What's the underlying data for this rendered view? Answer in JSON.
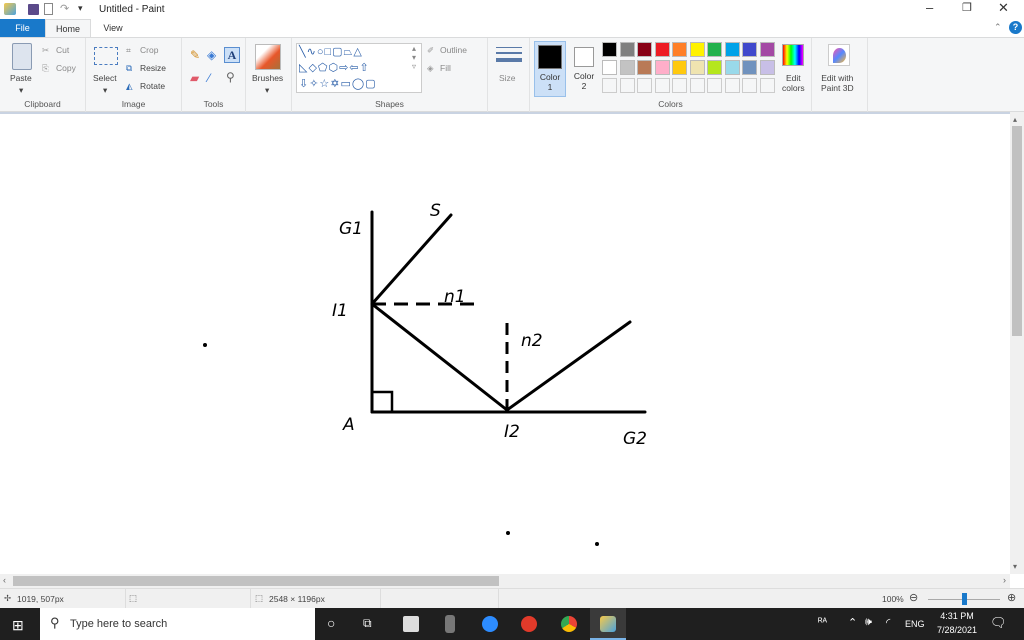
{
  "title": "Untitled - Paint",
  "tabs": [
    "File",
    "Home",
    "View"
  ],
  "clipboard": {
    "paste": "Paste",
    "cut": "Cut",
    "copy": "Copy",
    "label": "Clipboard"
  },
  "image": {
    "select": "Select",
    "crop": "Crop",
    "resize": "Resize",
    "rotate": "Rotate",
    "label": "Image"
  },
  "tools": {
    "label": "Tools"
  },
  "brushes": "Brushes",
  "shapes": {
    "outline": "Outline",
    "fill": "Fill",
    "label": "Shapes"
  },
  "size": "Size",
  "colors": {
    "color1": "Color",
    "color1n": "1",
    "color2": "Color",
    "color2n": "2",
    "edit1": "Edit",
    "edit2": "colors",
    "label": "Colors",
    "palette": [
      "#000000",
      "#7f7f7f",
      "#880015",
      "#ed1c24",
      "#ff7f27",
      "#fff200",
      "#22b14c",
      "#00a2e8",
      "#3f48cc",
      "#a349a4",
      "#ffffff",
      "#c3c3c3",
      "#b97a57",
      "#ffaec9",
      "#ffc90e",
      "#efe4b0",
      "#b5e61d",
      "#99d9ea",
      "#7092be",
      "#c8bfe7"
    ]
  },
  "paint3d": {
    "l1": "Edit with",
    "l2": "Paint 3D"
  },
  "drawing": {
    "labels": {
      "g1": "G1",
      "s": "S",
      "i1": "I1",
      "n1": "n1",
      "n2": "n2",
      "a": "A",
      "i2": "I2",
      "g2": "G2"
    }
  },
  "status": {
    "cursor": "1019, 507px",
    "size": "2548 × 1196px",
    "zoom": "100%"
  },
  "taskbar": {
    "search": "Type here to search",
    "lang": "ENG",
    "time": "4:31 PM",
    "date": "7/28/2021"
  }
}
